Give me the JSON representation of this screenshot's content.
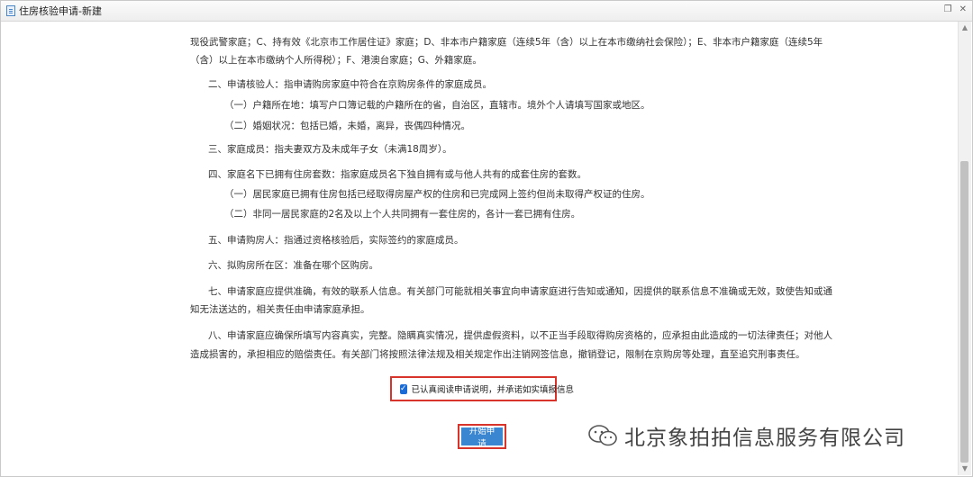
{
  "window": {
    "title": "住房核验申请-新建",
    "controls": [
      "restore-icon",
      "close-icon"
    ]
  },
  "notes": {
    "l1": "现役武警家庭；C、持有效《北京市工作居住证》家庭；D、非本市户籍家庭（连续5年（含）以上在本市缴纳社会保险）；E、非本市户籍家庭（连续5年",
    "l2": "（含）以上在本市缴纳个人所得税）；F、港澳台家庭；G、外籍家庭。",
    "s2": "二、申请核验人：指申请购房家庭中符合在京购房条件的家庭成员。",
    "s2a": "（一）户籍所在地：填写户口簿记载的户籍所在的省，自治区，直辖市。境外个人请填写国家或地区。",
    "s2b": "（二）婚姻状况：包括已婚，未婚，离异，丧偶四种情况。",
    "s3": "三、家庭成员：指夫妻双方及未成年子女（未满18周岁）。",
    "s4": "四、家庭名下已拥有住房套数：指家庭成员名下独自拥有或与他人共有的成套住房的套数。",
    "s4a": "（一）居民家庭已拥有住房包括已经取得房屋产权的住房和已完成网上签约但尚未取得产权证的住房。",
    "s4b": "（二）非同一居民家庭的2名及以上个人共同拥有一套住房的，各计一套已拥有住房。",
    "s5": "五、申请购房人：指通过资格核验后，实际签约的家庭成员。",
    "s6": "六、拟购房所在区：准备在哪个区购房。",
    "s7a": "七、申请家庭应提供准确，有效的联系人信息。有关部门可能就相关事宜向申请家庭进行告知或通知，因提供的联系信息不准确或无效，致使告知或通",
    "s7b": "知无法送达的，相关责任由申请家庭承担。",
    "s8a": "八、申请家庭应确保所填写内容真实，完整。隐瞒真实情况，提供虚假资料，以不正当手段取得购房资格的，应承担由此造成的一切法律责任；对他人",
    "s8b": "造成损害的，承担相应的赔偿责任。有关部门将按照法律法规及相关规定作出注销网签信息，撤销登记，限制在京购房等处理，直至追究刑事责任。"
  },
  "agreement": {
    "checked": true,
    "label": "已认真阅读申请说明，并承诺如实填报信息"
  },
  "actions": {
    "start_label": "开始申请"
  },
  "watermark": {
    "text": "北京象拍拍信息服务有限公司"
  },
  "colors": {
    "highlight": "#d9342b",
    "primary_button": "#3b86d0",
    "checkbox": "#1b6bd6"
  }
}
